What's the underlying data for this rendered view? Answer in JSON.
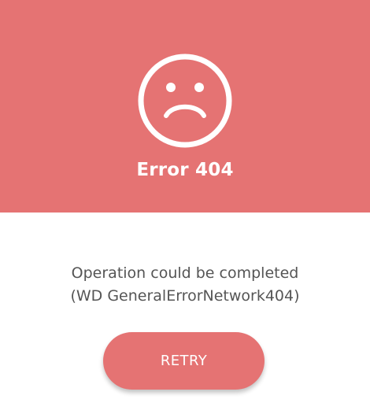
{
  "error": {
    "title": "Error 404",
    "icon": "sad-face-icon",
    "message_line_1": "Operation could be completed",
    "message_line_2": "(WD GeneralErrorNetwork404)"
  },
  "actions": {
    "retry_label": "RETRY"
  },
  "colors": {
    "header_background": "#e57373",
    "button_background": "#e57373",
    "text": "#555555",
    "icon": "#ffffff"
  }
}
